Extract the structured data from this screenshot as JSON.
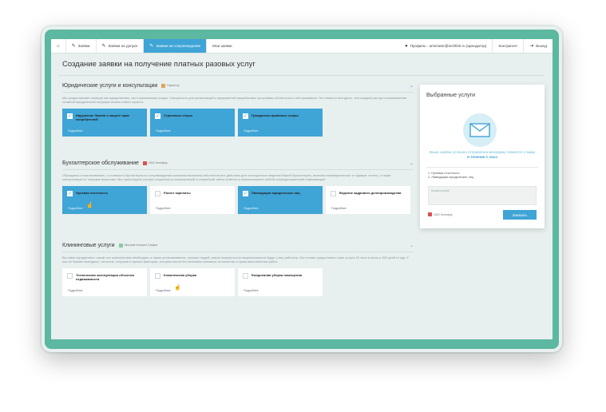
{
  "nav": {
    "home_icon": "home-icon",
    "items": [
      {
        "label": "Заявки",
        "icon": "edit-icon"
      },
      {
        "label": "Заявки на допуск",
        "icon": "edit-icon"
      },
      {
        "label": "Заявки на сопровождение",
        "icon": "edit-icon"
      },
      {
        "label": "Мои заявки"
      }
    ],
    "profile": "Профиль - amirzator@techfish.ru (арендатор)",
    "counterparty": "Контрагент",
    "logout": "Выход"
  },
  "page_title": "Создание заявки на получение платных разовых услуг",
  "sections": [
    {
      "title": "Юридические услуги и консультации",
      "provider": "Гарантор",
      "description": "Мы предоставляет помощь как юридическим, так и физическим лицам. Специально для организаций и предприятий разработаны программы абонентского обслуживания. Это намного выгоднее, чем каждый раз при возникновении сложной юридической ситуации искать нового юриста.",
      "cards": [
        {
          "name": "Нарушение Закона о защите прав потребителей",
          "more": "Подробнее",
          "selected": true
        },
        {
          "name": "Страховые споры",
          "more": "Подробнее",
          "selected": true
        },
        {
          "name": "Гражданско-правовые споры",
          "more": "Подробнее",
          "selected": true
        }
      ]
    },
    {
      "title": "Бухгалтерское обслуживание",
      "provider": "ОАО Коннфэр",
      "description": "Обращаясь в нам вниманию, и стоимость бухгалтерского сопровождения компании включены абсолютно все действия для полноценного ведения Вашей бухгалтерии, включая ежеквартальные и годовые отчеты, а также консультации по текущим вопросам. Мы гарантируем полную сохранность коммерческой и служебной тайны клиента и неразглашение любой конфиденциальной информации!",
      "cards": [
        {
          "name": "Нулевая отчетность",
          "more": "Подробнее",
          "selected": true
        },
        {
          "name": "Расчет зарплаты",
          "more": "Подробнее",
          "selected": false
        },
        {
          "name": "Ликвидация юридических лиц",
          "more": "Подробнее",
          "selected": true
        },
        {
          "name": "Ведение кадрового делопроизводства",
          "more": "Подробнее",
          "selected": false
        }
      ]
    },
    {
      "title": "Клининговые услуги",
      "provider": "Absolute Клининг Сервис",
      "description": "Вы сами определяете, какой тип клининга вам необходим, а также устанавливаете, сколько людей, какого возраста или национальности будут у вас работать. Мы готовы предоставить свои услуги 24 часа в сутки и 365 дней в году. У нас не бывает выходных, отгоолов, отпусков и прочих факторов, которые могли бы негативно повлиять на качество и сроки выполненных работ.",
      "cards": [
        {
          "name": "Техническая эксплуатация объектов недвижимости",
          "more": "Подробнее",
          "selected": false
        },
        {
          "name": "Комплексная уборка",
          "more": "Подробнее",
          "selected": false
        },
        {
          "name": "Ежедневная уборка помещения",
          "more": "Подробнее",
          "selected": false
        }
      ]
    }
  ],
  "panel": {
    "title": "Выбранные услуги",
    "success_text": "Ваша заявка успешно отправлена менеджер свяжется с вами",
    "success_time": "в течение 1 часа",
    "selected": [
      "1. Нулевая отчетность",
      "2. Ликвидация юридических лиц"
    ],
    "comment_placeholder": "Комментарий",
    "provider": "ОАО Коннфэр",
    "send_label": "Заказать"
  },
  "colors": {
    "accent": "#3fa4d6",
    "frame": "#5cb8a0",
    "provider_red": "#d9534f"
  }
}
